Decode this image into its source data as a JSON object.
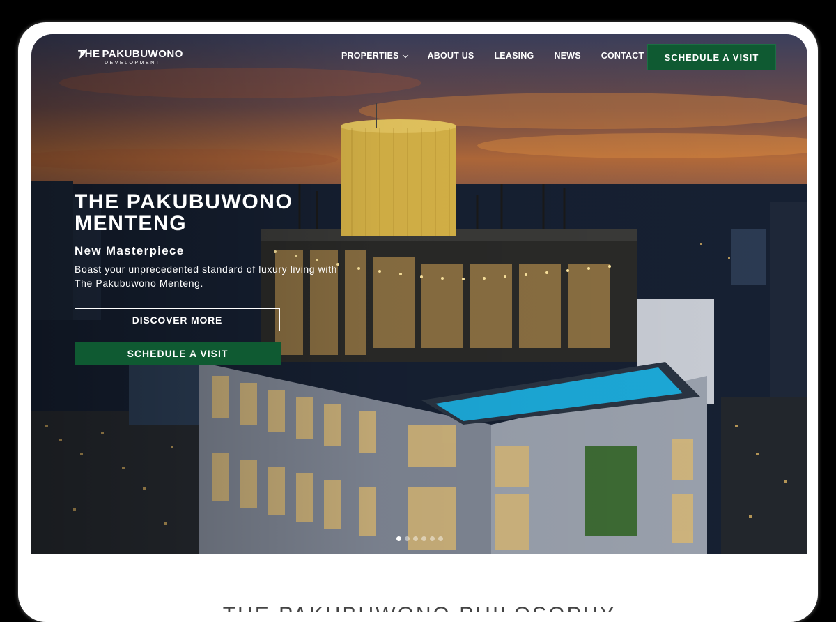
{
  "brand": {
    "name_left": "THE",
    "name_right": "PAKUBUWONO",
    "sub": "DEVELOPMENT"
  },
  "nav": {
    "items": [
      {
        "label": "PROPERTIES",
        "has_dropdown": true
      },
      {
        "label": "ABOUT US"
      },
      {
        "label": "LEASING"
      },
      {
        "label": "NEWS"
      },
      {
        "label": "CONTACT"
      }
    ],
    "cta_label": "SCHEDULE A VISIT"
  },
  "hero": {
    "title_line1": "THE PAKUBUWONO",
    "title_line2": "MENTENG",
    "subtitle": "New Masterpiece",
    "description": "Boast your unprecedented standard of luxury living with The Pakubuwono Menteng.",
    "discover_label": "DISCOVER MORE",
    "schedule_label": "SCHEDULE A VISIT",
    "slide_count": 6,
    "active_slide": 1
  },
  "section": {
    "title": "THE PAKUBUWONO PHILOSOPHY"
  },
  "colors": {
    "brand_green": "#0f5a32",
    "text_white": "#ffffff"
  }
}
